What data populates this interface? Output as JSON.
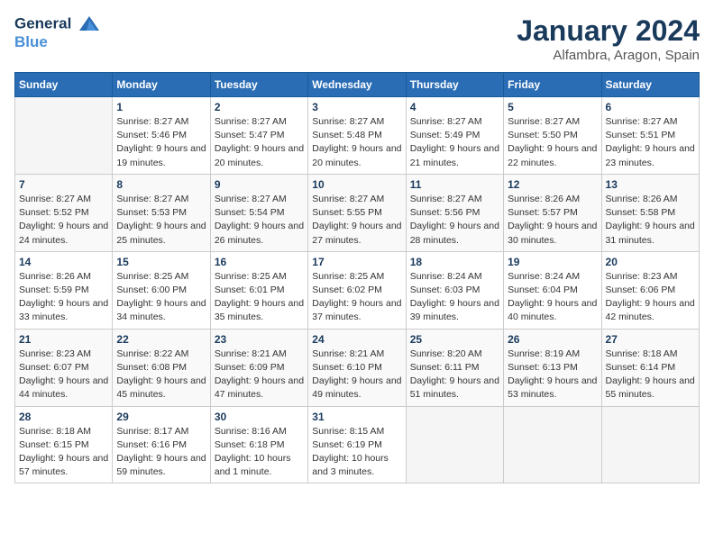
{
  "logo": {
    "line1": "General",
    "line2": "Blue"
  },
  "title": "January 2024",
  "location": "Alfambra, Aragon, Spain",
  "days_of_week": [
    "Sunday",
    "Monday",
    "Tuesday",
    "Wednesday",
    "Thursday",
    "Friday",
    "Saturday"
  ],
  "weeks": [
    [
      {
        "day": "",
        "sunrise": "",
        "sunset": "",
        "daylight": ""
      },
      {
        "day": "1",
        "sunrise": "Sunrise: 8:27 AM",
        "sunset": "Sunset: 5:46 PM",
        "daylight": "Daylight: 9 hours and 19 minutes."
      },
      {
        "day": "2",
        "sunrise": "Sunrise: 8:27 AM",
        "sunset": "Sunset: 5:47 PM",
        "daylight": "Daylight: 9 hours and 20 minutes."
      },
      {
        "day": "3",
        "sunrise": "Sunrise: 8:27 AM",
        "sunset": "Sunset: 5:48 PM",
        "daylight": "Daylight: 9 hours and 20 minutes."
      },
      {
        "day": "4",
        "sunrise": "Sunrise: 8:27 AM",
        "sunset": "Sunset: 5:49 PM",
        "daylight": "Daylight: 9 hours and 21 minutes."
      },
      {
        "day": "5",
        "sunrise": "Sunrise: 8:27 AM",
        "sunset": "Sunset: 5:50 PM",
        "daylight": "Daylight: 9 hours and 22 minutes."
      },
      {
        "day": "6",
        "sunrise": "Sunrise: 8:27 AM",
        "sunset": "Sunset: 5:51 PM",
        "daylight": "Daylight: 9 hours and 23 minutes."
      }
    ],
    [
      {
        "day": "7",
        "sunrise": "Sunrise: 8:27 AM",
        "sunset": "Sunset: 5:52 PM",
        "daylight": "Daylight: 9 hours and 24 minutes."
      },
      {
        "day": "8",
        "sunrise": "Sunrise: 8:27 AM",
        "sunset": "Sunset: 5:53 PM",
        "daylight": "Daylight: 9 hours and 25 minutes."
      },
      {
        "day": "9",
        "sunrise": "Sunrise: 8:27 AM",
        "sunset": "Sunset: 5:54 PM",
        "daylight": "Daylight: 9 hours and 26 minutes."
      },
      {
        "day": "10",
        "sunrise": "Sunrise: 8:27 AM",
        "sunset": "Sunset: 5:55 PM",
        "daylight": "Daylight: 9 hours and 27 minutes."
      },
      {
        "day": "11",
        "sunrise": "Sunrise: 8:27 AM",
        "sunset": "Sunset: 5:56 PM",
        "daylight": "Daylight: 9 hours and 28 minutes."
      },
      {
        "day": "12",
        "sunrise": "Sunrise: 8:26 AM",
        "sunset": "Sunset: 5:57 PM",
        "daylight": "Daylight: 9 hours and 30 minutes."
      },
      {
        "day": "13",
        "sunrise": "Sunrise: 8:26 AM",
        "sunset": "Sunset: 5:58 PM",
        "daylight": "Daylight: 9 hours and 31 minutes."
      }
    ],
    [
      {
        "day": "14",
        "sunrise": "Sunrise: 8:26 AM",
        "sunset": "Sunset: 5:59 PM",
        "daylight": "Daylight: 9 hours and 33 minutes."
      },
      {
        "day": "15",
        "sunrise": "Sunrise: 8:25 AM",
        "sunset": "Sunset: 6:00 PM",
        "daylight": "Daylight: 9 hours and 34 minutes."
      },
      {
        "day": "16",
        "sunrise": "Sunrise: 8:25 AM",
        "sunset": "Sunset: 6:01 PM",
        "daylight": "Daylight: 9 hours and 35 minutes."
      },
      {
        "day": "17",
        "sunrise": "Sunrise: 8:25 AM",
        "sunset": "Sunset: 6:02 PM",
        "daylight": "Daylight: 9 hours and 37 minutes."
      },
      {
        "day": "18",
        "sunrise": "Sunrise: 8:24 AM",
        "sunset": "Sunset: 6:03 PM",
        "daylight": "Daylight: 9 hours and 39 minutes."
      },
      {
        "day": "19",
        "sunrise": "Sunrise: 8:24 AM",
        "sunset": "Sunset: 6:04 PM",
        "daylight": "Daylight: 9 hours and 40 minutes."
      },
      {
        "day": "20",
        "sunrise": "Sunrise: 8:23 AM",
        "sunset": "Sunset: 6:06 PM",
        "daylight": "Daylight: 9 hours and 42 minutes."
      }
    ],
    [
      {
        "day": "21",
        "sunrise": "Sunrise: 8:23 AM",
        "sunset": "Sunset: 6:07 PM",
        "daylight": "Daylight: 9 hours and 44 minutes."
      },
      {
        "day": "22",
        "sunrise": "Sunrise: 8:22 AM",
        "sunset": "Sunset: 6:08 PM",
        "daylight": "Daylight: 9 hours and 45 minutes."
      },
      {
        "day": "23",
        "sunrise": "Sunrise: 8:21 AM",
        "sunset": "Sunset: 6:09 PM",
        "daylight": "Daylight: 9 hours and 47 minutes."
      },
      {
        "day": "24",
        "sunrise": "Sunrise: 8:21 AM",
        "sunset": "Sunset: 6:10 PM",
        "daylight": "Daylight: 9 hours and 49 minutes."
      },
      {
        "day": "25",
        "sunrise": "Sunrise: 8:20 AM",
        "sunset": "Sunset: 6:11 PM",
        "daylight": "Daylight: 9 hours and 51 minutes."
      },
      {
        "day": "26",
        "sunrise": "Sunrise: 8:19 AM",
        "sunset": "Sunset: 6:13 PM",
        "daylight": "Daylight: 9 hours and 53 minutes."
      },
      {
        "day": "27",
        "sunrise": "Sunrise: 8:18 AM",
        "sunset": "Sunset: 6:14 PM",
        "daylight": "Daylight: 9 hours and 55 minutes."
      }
    ],
    [
      {
        "day": "28",
        "sunrise": "Sunrise: 8:18 AM",
        "sunset": "Sunset: 6:15 PM",
        "daylight": "Daylight: 9 hours and 57 minutes."
      },
      {
        "day": "29",
        "sunrise": "Sunrise: 8:17 AM",
        "sunset": "Sunset: 6:16 PM",
        "daylight": "Daylight: 9 hours and 59 minutes."
      },
      {
        "day": "30",
        "sunrise": "Sunrise: 8:16 AM",
        "sunset": "Sunset: 6:18 PM",
        "daylight": "Daylight: 10 hours and 1 minute."
      },
      {
        "day": "31",
        "sunrise": "Sunrise: 8:15 AM",
        "sunset": "Sunset: 6:19 PM",
        "daylight": "Daylight: 10 hours and 3 minutes."
      },
      {
        "day": "",
        "sunrise": "",
        "sunset": "",
        "daylight": ""
      },
      {
        "day": "",
        "sunrise": "",
        "sunset": "",
        "daylight": ""
      },
      {
        "day": "",
        "sunrise": "",
        "sunset": "",
        "daylight": ""
      }
    ]
  ]
}
